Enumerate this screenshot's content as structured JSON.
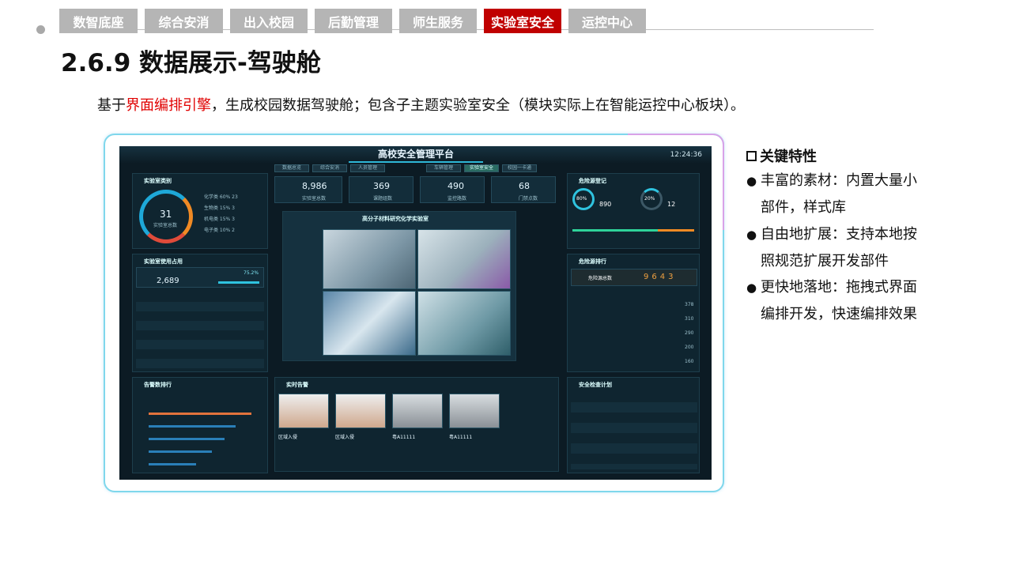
{
  "nav": {
    "tabs": [
      "数智底座",
      "综合安消",
      "出入校园",
      "后勤管理",
      "师生服务",
      "实验室安全",
      "运控中心"
    ],
    "active_index": 5
  },
  "page": {
    "title": "2.6.9 数据展示-驾驶舱",
    "desc_prefix": "基于",
    "desc_highlight": "界面编排引擎",
    "desc_suffix": "，生成校园数据驾驶舱；包含子主题实验室安全（模块实际上在智能运控中心板块）。"
  },
  "dashboard": {
    "title": "高校安全管理平台",
    "time": "12:24:36",
    "nav": [
      "数据总览",
      "综合安消",
      "人员管理",
      "车辆管理",
      "实验室安全",
      "校园一卡通"
    ],
    "panels": {
      "lab_class": "实验室类别",
      "lab_usage": "实验室使用占用",
      "alarm_rank": "告警数排行",
      "live_alarm": "实时告警",
      "inspection": "危险源登记",
      "risk_rank": "危险源排行",
      "safety_plan": "安全检查计划",
      "center": "高分子材料研究化学实验室"
    },
    "total": "31",
    "total_label": "实验室总数",
    "legend": [
      "化学类 60% 23",
      "生物类 15% 3",
      "机电类 15% 3",
      "电子类 10% 2"
    ],
    "stats": [
      {
        "v": "8,986",
        "l": "实验室总数"
      },
      {
        "v": "369",
        "l": "课题组数"
      },
      {
        "v": "490",
        "l": "监控路数"
      },
      {
        "v": "68",
        "l": "门禁点数"
      }
    ],
    "usage_v": "2,689",
    "usage_pct": "75.2%",
    "hazard_label": "危险源总数",
    "hazard_value": "9643",
    "pct_a": "80%",
    "val_a": "890",
    "pct_b": "20%",
    "val_b": "12",
    "alarm_people": [
      "区域入侵",
      "区域入侵",
      "粤A11111",
      "粤A11111"
    ],
    "rank_values": [
      "378",
      "310",
      "290",
      "200",
      "160"
    ]
  },
  "features": {
    "heading": "关键特性",
    "items": [
      {
        "lines": [
          "丰富的素材：内置大量小",
          "部件，样式库"
        ]
      },
      {
        "lines": [
          "自由地扩展：支持本地按",
          "照规范扩展开发部件"
        ]
      },
      {
        "lines": [
          "更快地落地：拖拽式界面",
          "编排开发，快速编排效果"
        ]
      }
    ]
  }
}
